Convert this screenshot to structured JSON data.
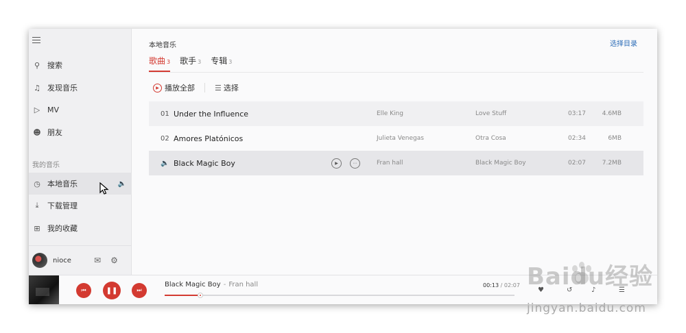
{
  "sidebar": {
    "items": [
      {
        "label": "搜索",
        "icon": "search-icon"
      },
      {
        "label": "发现音乐",
        "icon": "music-note-icon"
      },
      {
        "label": "MV",
        "icon": "video-icon"
      },
      {
        "label": "朋友",
        "icon": "friends-icon"
      }
    ],
    "section_title": "我的音乐",
    "my_items": [
      {
        "label": "本地音乐",
        "icon": "clock-icon",
        "active": true
      },
      {
        "label": "下载管理",
        "icon": "download-icon"
      },
      {
        "label": "我的收藏",
        "icon": "favorites-icon"
      }
    ],
    "user": {
      "name": "nioce"
    }
  },
  "main": {
    "title": "本地音乐",
    "select_dir": "选择目录",
    "tabs": [
      {
        "label": "歌曲",
        "count": "3",
        "active": true
      },
      {
        "label": "歌手",
        "count": "3"
      },
      {
        "label": "专辑",
        "count": "3"
      }
    ],
    "play_all": "播放全部",
    "select": "选择"
  },
  "songs": [
    {
      "num": "01",
      "title": "Under the Influence",
      "artist": "Elle King",
      "album": "Love Stuff",
      "duration": "03:17",
      "size": "4.6MB"
    },
    {
      "num": "02",
      "title": "Amores Platónicos",
      "artist": "Julieta Venegas",
      "album": "Otra Cosa",
      "duration": "02:34",
      "size": "6MB"
    },
    {
      "num": "",
      "title": "Black Magic Boy",
      "artist": "Fran hall",
      "album": "Black Magic Boy",
      "duration": "02:07",
      "size": "7.2MB",
      "playing": true
    }
  ],
  "player": {
    "title": "Black Magic Boy",
    "separator": "-",
    "artist": "Fran hall",
    "elapsed": "00:13",
    "slash": "/",
    "total": "02:07",
    "progress_fraction": 0.102
  },
  "colors": {
    "accent": "#d33a31",
    "link": "#2b6cb7"
  },
  "watermark": {
    "text": "Baidu经验",
    "url": "jingyan.baidu.com"
  }
}
